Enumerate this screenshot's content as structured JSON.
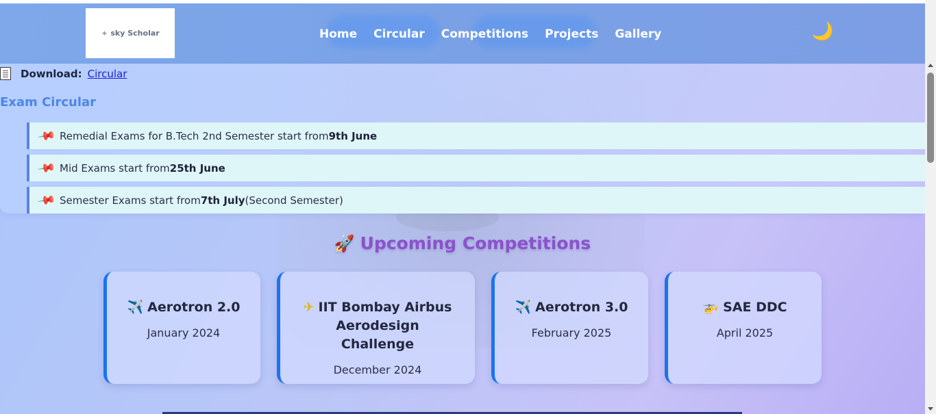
{
  "header": {
    "logo_text": "sky Scholar",
    "nav": [
      "Home",
      "Circular",
      "Competitions",
      "Projects",
      "Gallery"
    ],
    "theme_toggle_icon": "moon-icon"
  },
  "circular": {
    "download_label": "Download:",
    "download_link": "Circular",
    "exam_title": "Exam Circular",
    "notices": [
      {
        "text": "Remedial Exams for B.Tech 2nd Semester start from",
        "bold": "9th June",
        "suffix": ""
      },
      {
        "text": "Mid Exams start from",
        "bold": "25th June",
        "suffix": ""
      },
      {
        "text": "Semester Exams start from",
        "bold": "7th July",
        "suffix": "(Second Semester)"
      }
    ]
  },
  "competitions": {
    "title": "Upcoming Competitions",
    "cards": [
      {
        "icon": "✈️",
        "name": "Aerotron 2.0",
        "date": "January 2024"
      },
      {
        "icon": "✈",
        "name": "IIT Bombay Airbus Aerodesign Challenge",
        "date": "December 2024"
      },
      {
        "icon": "✈️",
        "name": "Aerotron 3.0",
        "date": "February 2025"
      },
      {
        "icon": "🚁",
        "name": "SAE DDC",
        "date": "April 2025"
      }
    ]
  },
  "colors": {
    "header": "#7aa1e6",
    "accent_blue": "#1b73f0",
    "title_purple": "#8b52cc",
    "notice_bg": "#dff6f9"
  }
}
